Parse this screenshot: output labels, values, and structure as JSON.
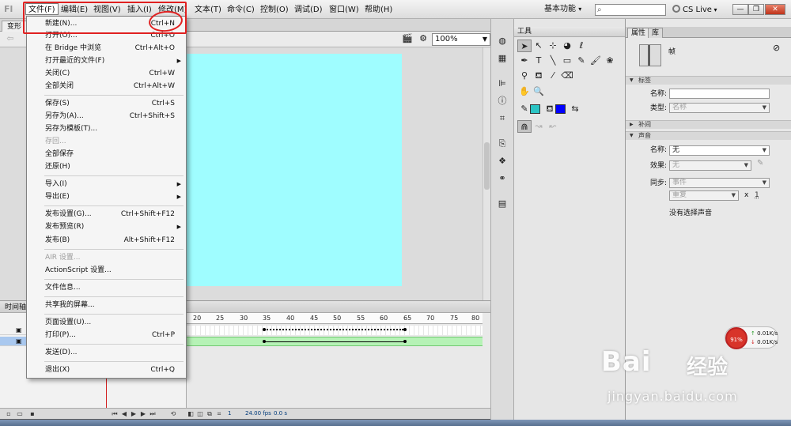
{
  "menubar": {
    "items": [
      "文件(F)",
      "编辑(E)",
      "视图(V)",
      "插入(I)",
      "修改(M)",
      "文本(T)",
      "命令(C)",
      "控制(O)",
      "调试(D)",
      "窗口(W)",
      "帮助(H)"
    ],
    "workspace": "基本功能",
    "cs_live": "CS Live"
  },
  "document": {
    "tab_label": "变形",
    "zoom": "100%",
    "stage_color": "#9ffdff"
  },
  "file_menu": {
    "items": [
      {
        "label": "新建(N)...",
        "shortcut": "Ctrl+N"
      },
      {
        "label": "打开(O)...",
        "shortcut": "Ctrl+O"
      },
      {
        "label": "在 Bridge 中浏览",
        "shortcut": "Ctrl+Alt+O"
      },
      {
        "label": "打开最近的文件(F)",
        "shortcut": ""
      },
      {
        "label": "关闭(C)",
        "shortcut": "Ctrl+W"
      },
      {
        "label": "全部关闭",
        "shortcut": "Ctrl+Alt+W"
      },
      {
        "label": "保存(S)",
        "shortcut": "Ctrl+S"
      },
      {
        "label": "另存为(A)...",
        "shortcut": "Ctrl+Shift+S"
      },
      {
        "label": "另存为模板(T)...",
        "shortcut": ""
      },
      {
        "label": "存回...",
        "shortcut": ""
      },
      {
        "label": "全部保存",
        "shortcut": ""
      },
      {
        "label": "还原(H)",
        "shortcut": ""
      },
      {
        "label": "导入(I)",
        "shortcut": ""
      },
      {
        "label": "导出(E)",
        "shortcut": ""
      },
      {
        "label": "发布设置(G)...",
        "shortcut": "Ctrl+Shift+F12"
      },
      {
        "label": "发布预览(R)",
        "shortcut": ""
      },
      {
        "label": "发布(B)",
        "shortcut": "Alt+Shift+F12"
      },
      {
        "label": "AIR 设置...",
        "shortcut": ""
      },
      {
        "label": "ActionScript 设置...",
        "shortcut": ""
      },
      {
        "label": "文件信息...",
        "shortcut": ""
      },
      {
        "label": "共享我的屏幕...",
        "shortcut": ""
      },
      {
        "label": "页面设置(U)...",
        "shortcut": ""
      },
      {
        "label": "打印(P)...",
        "shortcut": "Ctrl+P"
      },
      {
        "label": "发送(D)...",
        "shortcut": ""
      },
      {
        "label": "退出(X)",
        "shortcut": "Ctrl+Q"
      }
    ]
  },
  "timeline": {
    "tab": "时间轴",
    "ruler": [
      "20",
      "25",
      "30",
      "35",
      "40",
      "45",
      "50",
      "55",
      "60",
      "65",
      "70",
      "75",
      "80"
    ],
    "fps": "24.00 fps",
    "time": "0.0 s",
    "frame": "1"
  },
  "tools": {
    "title": "工具",
    "stroke_color": "#2bc4c4",
    "fill_color": "#0000ff"
  },
  "properties": {
    "tabs": [
      "属性",
      "库"
    ],
    "type_label": "帧",
    "label_section": "标签",
    "name_label": "名称:",
    "type_field_label": "类型:",
    "type_value": "名称",
    "tween_section": "补间",
    "sound_section": "声音",
    "sound_name_label": "名称:",
    "sound_name_value": "无",
    "effect_label": "效果:",
    "effect_value": "无",
    "sync_label": "同步:",
    "sync_value": "事件",
    "repeat_value": "重复",
    "repeat_x": "x",
    "repeat_count": "1",
    "no_sound": "没有选择声音"
  },
  "speed_widget": {
    "percent": "91%",
    "up": "0.01K/s",
    "down": "0.01K/s"
  },
  "watermark": {
    "brand": "Bai",
    "cn": "经验",
    "url": "jingyan.baidu.com"
  }
}
